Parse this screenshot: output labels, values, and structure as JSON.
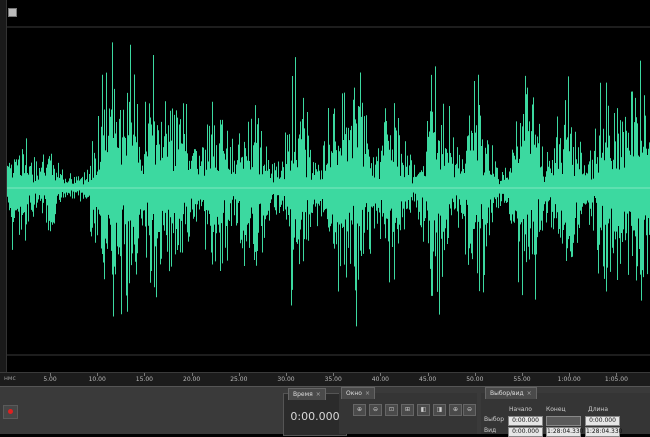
{
  "ruler": {
    "unit": "нмс",
    "ticks": [
      "5.00",
      "10.00",
      "15.00",
      "20.00",
      "25.00",
      "30.00",
      "35.00",
      "40.00",
      "45.00",
      "50.00",
      "55.00",
      "1:00.00",
      "1:05.00"
    ]
  },
  "time_panel": {
    "tab": "Время",
    "value": "0:00.000"
  },
  "zoom_panel": {
    "tab": "Окно"
  },
  "selection_panel": {
    "tab": "Выбор/вид",
    "headers": {
      "start": "Начало",
      "end": "Конец",
      "length": "Длина"
    },
    "rows": [
      {
        "label": "Выбор",
        "start": "0:00.000",
        "end": "",
        "length": "0:00.000"
      },
      {
        "label": "Вид",
        "start": "0:00.000",
        "end": "1:28:04.330",
        "length": "1:28:04.330"
      }
    ]
  },
  "colors": {
    "waveform": "#3cd9a0",
    "centerline": "#ffffff",
    "background": "#000000"
  },
  "icons": [
    "record-icon",
    "zoom-in-icon",
    "zoom-out-icon",
    "zoom-full-icon",
    "zoom-selection-icon"
  ]
}
